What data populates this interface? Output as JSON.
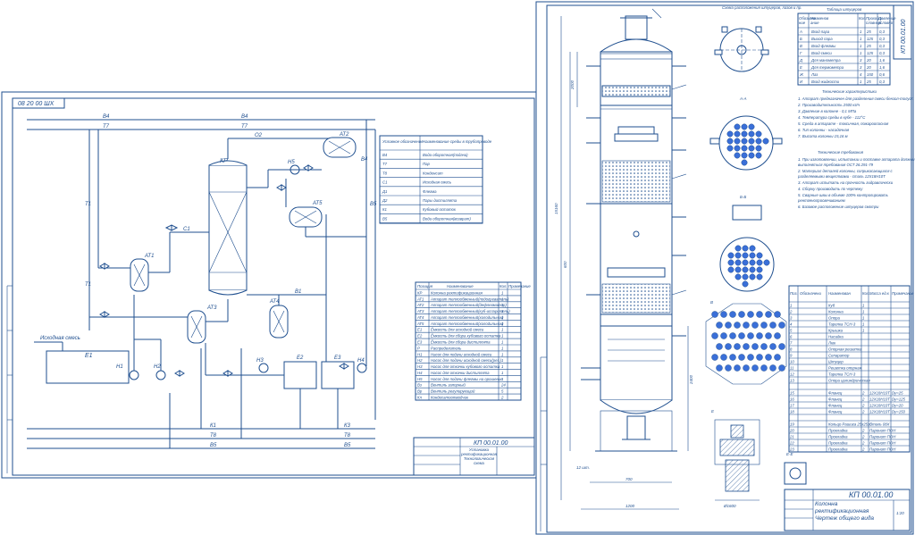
{
  "left_sheet": {
    "code_box": "08 20 00 ШХ",
    "lines": {
      "b4": "В4",
      "t7": "Т7",
      "o2": "О2",
      "t1": "Т1",
      "t8": "Т8",
      "b5": "В5",
      "k1": "К1",
      "k3": "К3",
      "b1": "В1",
      "c1": "С1"
    },
    "equipment": {
      "column": "КР",
      "at2": "АТ2",
      "at1": "АТ1",
      "at3": "АТ3",
      "at4": "АТ4",
      "at5": "АТ5",
      "e1": "Е1",
      "e2": "Е2",
      "e3": "Е3",
      "n1": "Н1",
      "n2": "Н2",
      "n3": "Н3",
      "n4": "Н4",
      "n5": "Н5",
      "raw_mix": "Исходная смесь"
    },
    "legend_headers": [
      "Условное обозначение",
      "Наименование среды в трубопроводе"
    ],
    "legend_rows": [
      [
        "В4",
        "Вода оборотная(подача)"
      ],
      [
        "Т7",
        "Пар"
      ],
      [
        "Т8",
        "Конденсат"
      ],
      [
        "С1",
        "Исходная смесь"
      ],
      [
        "Д1",
        "Флегма"
      ],
      [
        "Д2",
        "Пары дистиллята"
      ],
      [
        "К1",
        "Кубовый остаток"
      ],
      [
        "В5",
        "Вода оборотная(возврат)"
      ]
    ],
    "spec_headers": [
      "Позиция",
      "Наименование",
      "Кол.",
      "Примечание"
    ],
    "spec_rows": [
      [
        "КР",
        "Колонна ректификационная",
        "1"
      ],
      [
        "АТ1",
        "Аппарат теплообменный(подогреватель)",
        "1"
      ],
      [
        "АТ2",
        "Аппарат теплообменный(дефлегматор)",
        "1"
      ],
      [
        "АТ3",
        "Аппарат теплообменный(куб-испаритель)",
        "1"
      ],
      [
        "АТ4",
        "Аппарат теплообменный(холодильник)",
        "1"
      ],
      [
        "АТ5",
        "Аппарат теплообменный(холодильник)",
        "1"
      ],
      [
        "Е1",
        "Ёмкость для исходной смеси",
        "1"
      ],
      [
        "Е2",
        "Ёмкость для сбора кубового остатка",
        "1"
      ],
      [
        "Е3",
        "Ёмкость для сбора дистиллята",
        "1"
      ],
      [
        "Р",
        "Распределитель",
        "1"
      ],
      [
        "Н1",
        "Насос для подачи исходной смеси",
        "1"
      ],
      [
        "Н2",
        "Насос для подачи исходной смеси(рез.)",
        "1"
      ],
      [
        "Н3",
        "Насос для откачки кубового остатка",
        "1"
      ],
      [
        "Н4",
        "Насос для откачки дистиллята",
        "1"
      ],
      [
        "Н5",
        "Насос для подачи флегмы на орошение",
        "1"
      ],
      [
        "Вз",
        "Вентиль запорный",
        "24"
      ],
      [
        "Вр",
        "Вентиль регулирующий",
        "5"
      ],
      [
        "Кл",
        "Кондесатоотводчик",
        "2"
      ]
    ],
    "title_code": "КП 00.01.00",
    "title_name": "Установка ректификационная Технологическая схема"
  },
  "right_sheet": {
    "nozzle_scheme_title": "Схема расположения штуцеров, лазов и пр.",
    "nozzle_table_title": "Таблица штуцеров",
    "nozzle_headers": [
      "Обозначение",
      "Наименование",
      "Кол.",
      "Проход условный Dy,мм",
      "Давление условное Py,МПа"
    ],
    "nozzle_rows": [
      [
        "А",
        "Вход пара",
        "1",
        "25",
        "0,3"
      ],
      [
        "Б",
        "Выход пара",
        "1",
        "125",
        "0,3"
      ],
      [
        "В",
        "Вход флегмы",
        "1",
        "25",
        "0,3"
      ],
      [
        "Г",
        "Вход смеси",
        "1",
        "125",
        "0,3"
      ],
      [
        "Д",
        "Для манометра",
        "3",
        "20",
        "1,6"
      ],
      [
        "Е",
        "Для термометра",
        "3",
        "20",
        "1,6"
      ],
      [
        "Ж",
        "Лаз",
        "4",
        "150",
        "0,6"
      ],
      [
        "И",
        "Вход жидкости",
        "1",
        "25",
        "0,3"
      ]
    ],
    "tech_title": "Технические характеристики",
    "tech_items": [
      "1. Аппарат предназначен для разделения смеси бензол-толуол",
      "2. Производительность 2500 кг/ч",
      "3. Давление в колонне - 0,1 МПа",
      "4. Температура среды в кубе - 112°С",
      "5. Среда в аппарате - токсичная, пожароопасная",
      "6. Тип колонны - насадочная",
      "7. Высота колонны 15,16 м"
    ],
    "req_title": "Технические требования",
    "req_items": [
      "1. При изготовлении, испытании и поставке аппарата должны выполняться требования ОСТ 26.291-79",
      "2. Материал деталей колонны, соприкасающихся с разделяемыми веществами - сталь 12Х18Н10Т",
      "3. Аппарат испытать на прочность гидравлически",
      "4. Сборку производить по чертежу",
      "5. Сварные швы в объеме 100% контролировать рентгенопросвечиванием",
      "6. Базовое расположение штуцеров смотри"
    ],
    "section_labels": [
      "А-А",
      "Б-Б",
      "В",
      "Е",
      "Е-Е"
    ],
    "parts_headers": [
      "Поз.",
      "Обозначение",
      "Наименование",
      "Кол.",
      "Масса ед.кг",
      "Примечание"
    ],
    "parts_rows": [
      [
        "1",
        "",
        "Куб",
        "1",
        "",
        ""
      ],
      [
        "2",
        "",
        "Колонна",
        "1",
        "",
        ""
      ],
      [
        "3",
        "",
        "Опора",
        "1",
        "",
        ""
      ],
      [
        "4",
        "",
        "Тарелка ТСН-3",
        "1",
        "",
        ""
      ],
      [
        "5",
        "",
        "Крышка",
        "1",
        "",
        ""
      ],
      [
        "6",
        "",
        "Насадка",
        "",
        "",
        ""
      ],
      [
        "7",
        "",
        "Люк",
        "",
        "",
        ""
      ],
      [
        "8",
        "",
        "Опорная решетка",
        "",
        "",
        ""
      ],
      [
        "9",
        "",
        "Сепаратор",
        "",
        "",
        ""
      ],
      [
        "10",
        "",
        "Штуцер",
        "",
        "",
        ""
      ],
      [
        "11",
        "",
        "Решетка опорная",
        "",
        "",
        ""
      ],
      [
        "12",
        "",
        "Тарелка ТСН-3",
        "",
        "",
        ""
      ],
      [
        "13",
        "",
        "Опора цилиндрическая",
        "",
        "",
        ""
      ],
      [
        "",
        "",
        "",
        "",
        "",
        ""
      ],
      [
        "15",
        "",
        "Фланец",
        "2",
        "12Х18Н10Т",
        "Dy=25"
      ],
      [
        "16",
        "",
        "Фланец",
        "2",
        "12Х18Н10Т",
        "Dy=125"
      ],
      [
        "17",
        "",
        "Фланец",
        "2",
        "12Х18Н10Т",
        "Dy=20"
      ],
      [
        "18",
        "",
        "Фланец",
        "2",
        "12Х18Н10Т",
        "Dy=150"
      ],
      [
        "",
        "",
        "",
        "",
        "",
        ""
      ],
      [
        "19",
        "",
        "Кольцо Рашига 25х25х3",
        "",
        "Сталь 08Х",
        ""
      ],
      [
        "20",
        "",
        "Прокладка",
        "2",
        "Паронит ПОН",
        ""
      ],
      [
        "21",
        "",
        "Прокладка",
        "2",
        "Паронит ПОН",
        ""
      ],
      [
        "22",
        "",
        "Прокладка",
        "2",
        "Паронит ПОН",
        ""
      ],
      [
        "23",
        "",
        "Прокладка",
        "2",
        "Паронит ПОН",
        ""
      ]
    ],
    "dims": [
      "2000",
      "15160",
      "1200",
      "600",
      "1100",
      "2400",
      "3800",
      "1000",
      "Ø1600",
      "700",
      "12 шт."
    ],
    "title_code": "КП 00.01.00",
    "title_name": "Колонна ректификационная Чертеж общего вида",
    "scale": "1:20"
  }
}
